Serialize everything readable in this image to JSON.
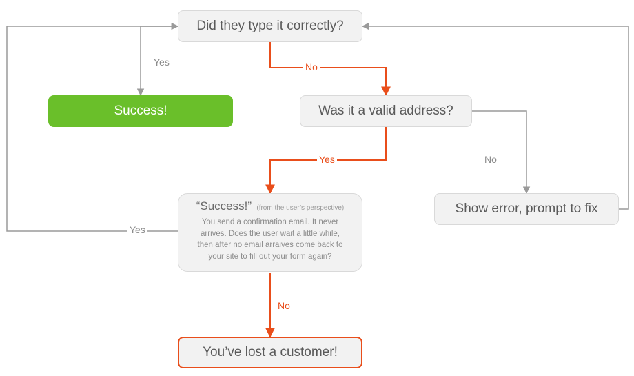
{
  "nodes": {
    "q1": "Did they type it correctly?",
    "success": "Success!",
    "q2": "Was it a valid address?",
    "fake_success_lead": "“Success!”",
    "fake_success_sub": "(from the user’s perspective)",
    "fake_success_body": "You send a confirmation email. It never arrives. Does the user wait a little while, then after no email arraives come back to your site to fill out your form again?",
    "show_error": "Show error, prompt to fix",
    "lost": "You’ve lost a customer!"
  },
  "edges": {
    "q1_yes": "Yes",
    "q1_no": "No",
    "q2_yes": "Yes",
    "q2_no": "No",
    "fake_yes": "Yes",
    "fake_no": "No"
  },
  "colors": {
    "accent_green": "#6abf2a",
    "accent_red": "#e94e1b",
    "line_gray": "#9a9a9a"
  }
}
